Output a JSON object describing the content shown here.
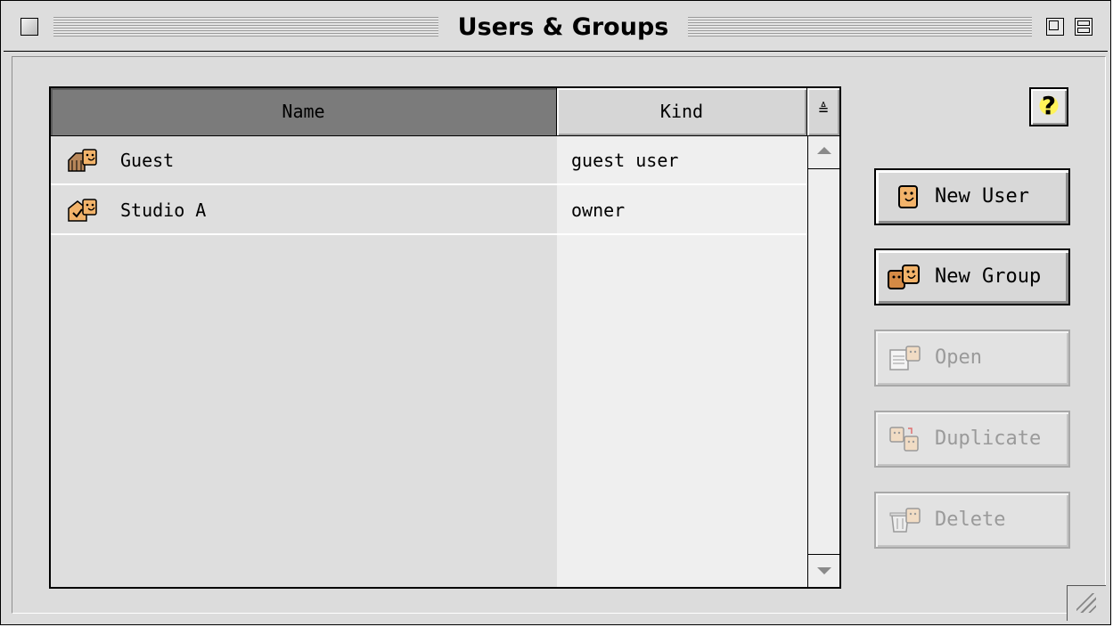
{
  "window": {
    "title": "Users & Groups"
  },
  "list": {
    "columns": [
      "Name",
      "Kind"
    ],
    "sort_indicator": "≜",
    "rows": [
      {
        "name": "Guest",
        "kind": "guest user",
        "icon": "guest-user-icon"
      },
      {
        "name": "Studio A",
        "kind": "owner",
        "icon": "owner-user-icon"
      }
    ]
  },
  "help": {
    "label": "?"
  },
  "buttons": {
    "new_user": {
      "label": "New User",
      "icon": "new-user-icon",
      "enabled": true
    },
    "new_group": {
      "label": "New Group",
      "icon": "new-group-icon",
      "enabled": true
    },
    "open": {
      "label": "Open",
      "icon": "open-icon",
      "enabled": false
    },
    "duplicate": {
      "label": "Duplicate",
      "icon": "duplicate-icon",
      "enabled": false
    },
    "delete": {
      "label": "Delete",
      "icon": "delete-icon",
      "enabled": false
    }
  },
  "colors": {
    "face": "#f2b36a",
    "face_dark": "#c7813a",
    "header_selected": "#7b7b7b",
    "window_bg": "#dcdcdc"
  }
}
